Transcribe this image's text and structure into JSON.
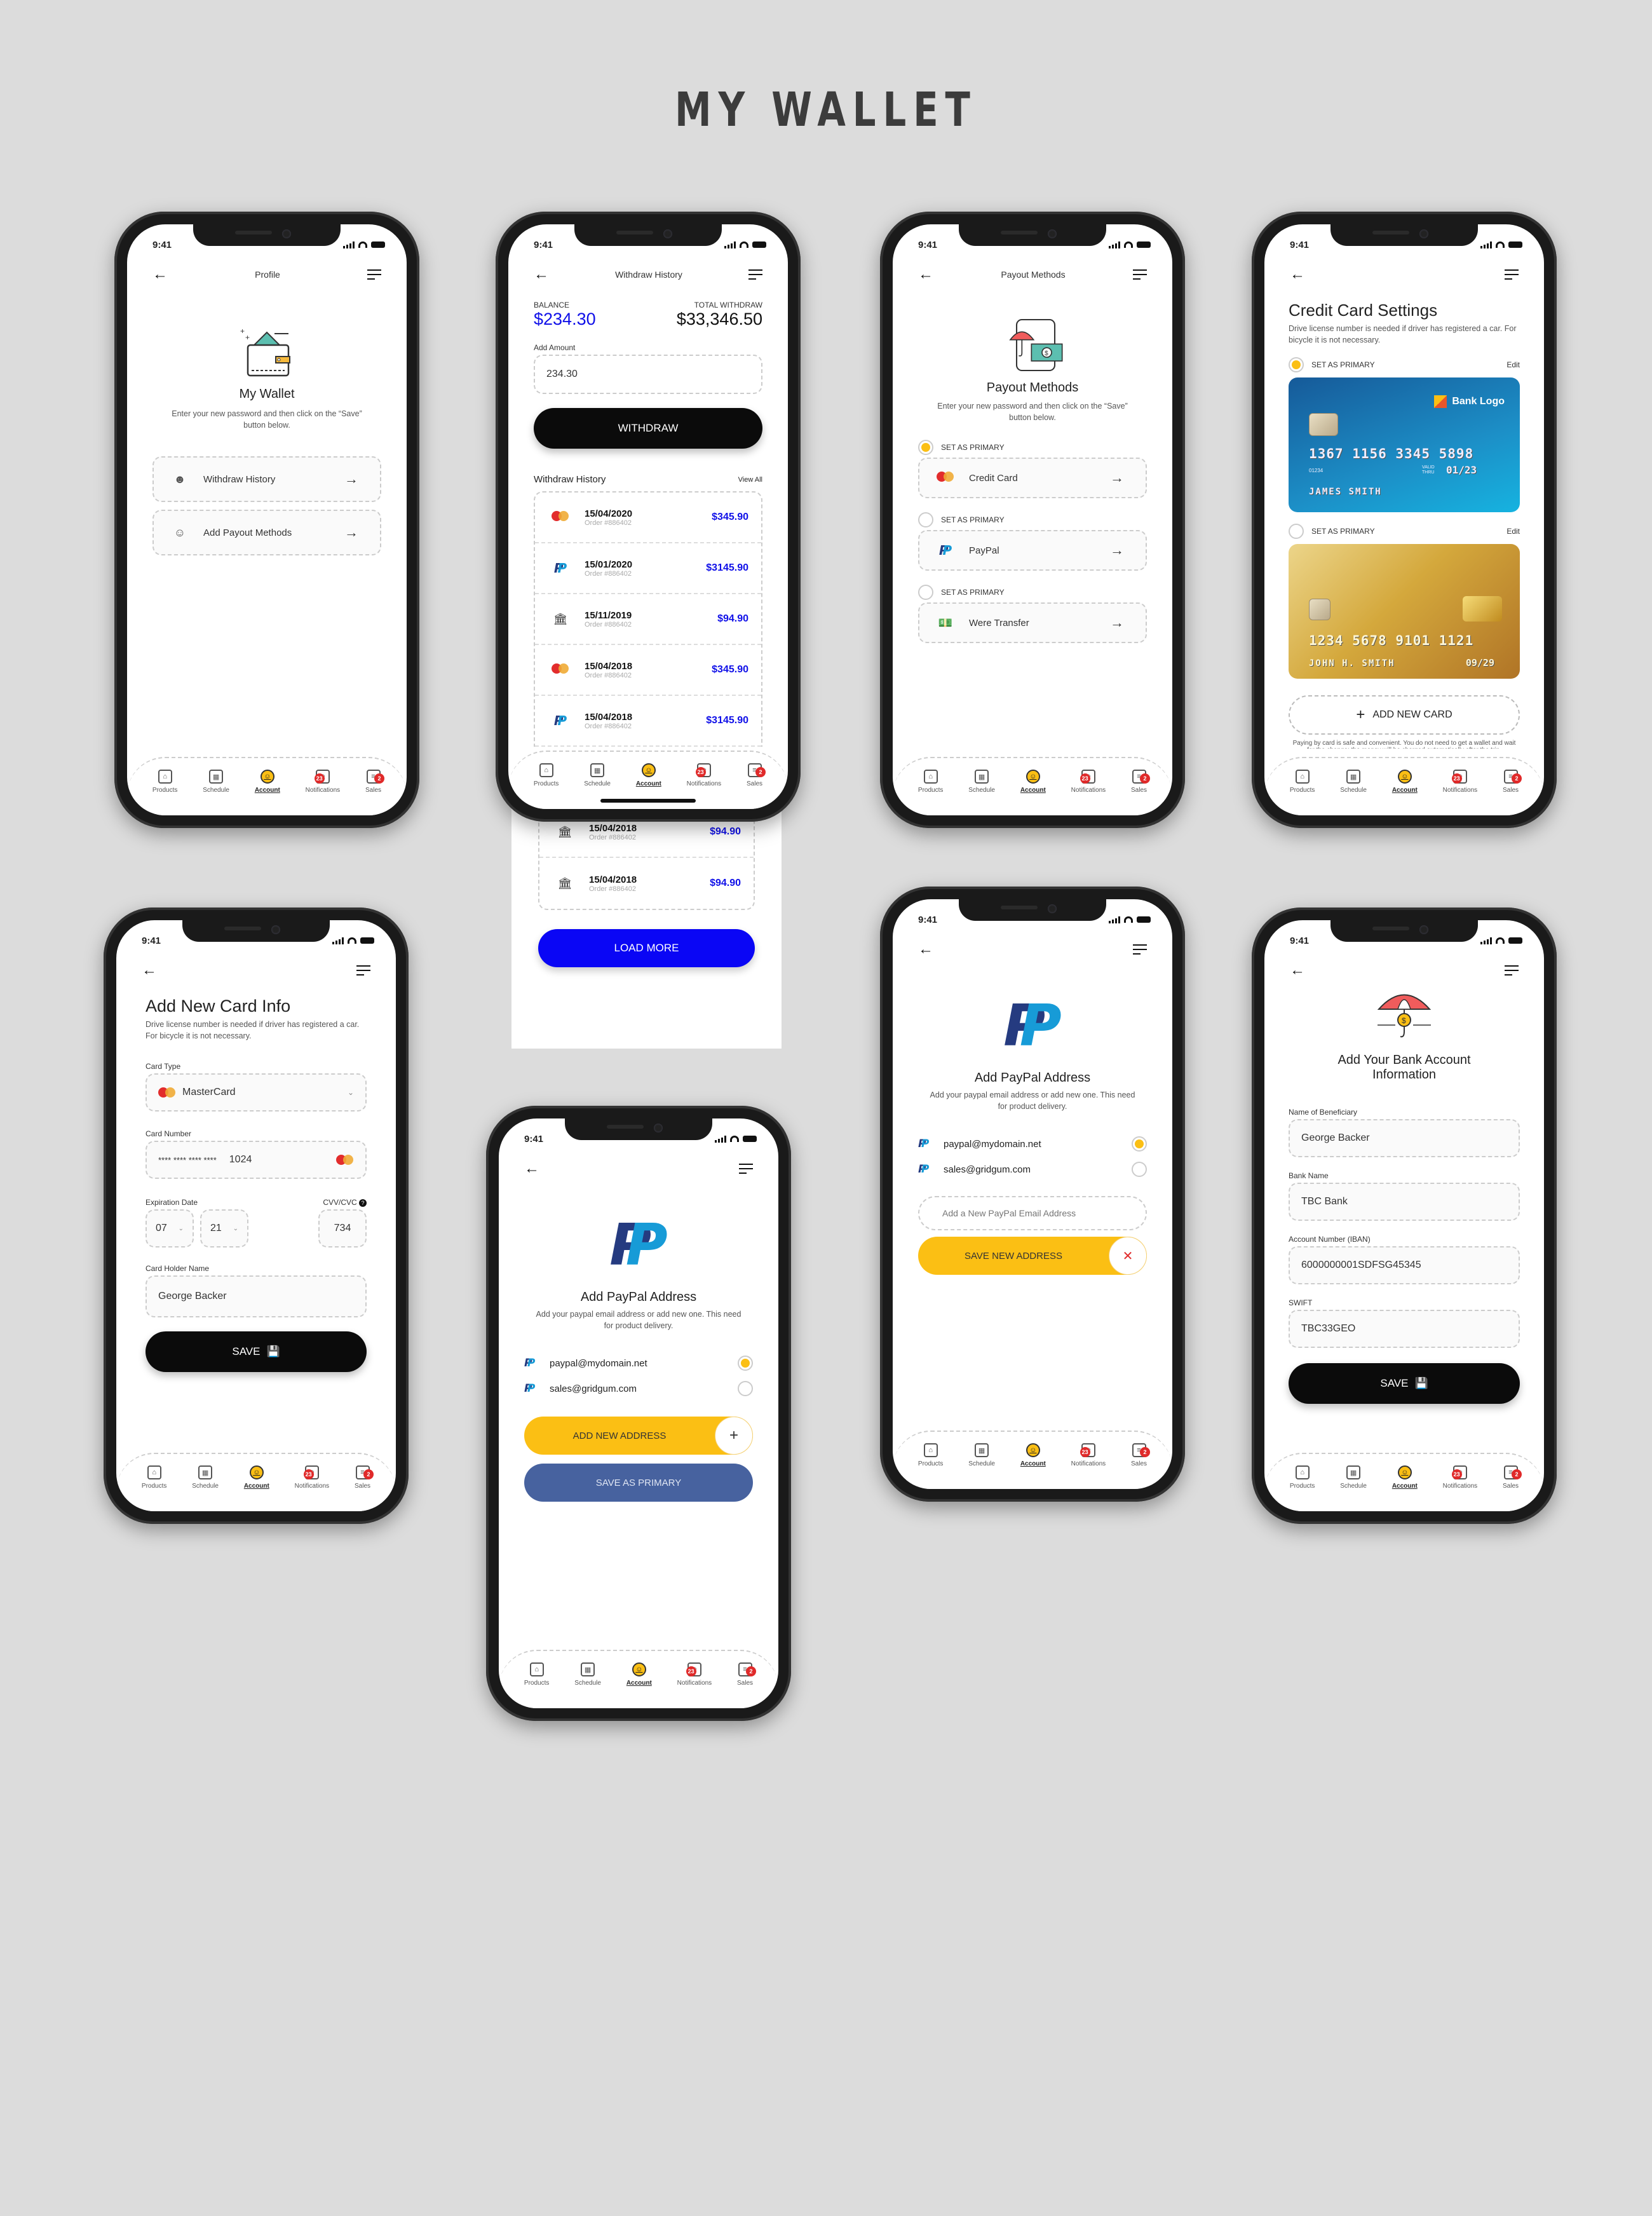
{
  "page_title": "MY WALLET",
  "status_time": "9:41",
  "tabbar": {
    "items": [
      {
        "label": "Products",
        "icon": "store-icon"
      },
      {
        "label": "Schedule",
        "icon": "calendar-icon"
      },
      {
        "label": "Account",
        "icon": "user-icon",
        "active": true
      },
      {
        "label": "Notifications",
        "icon": "bell-icon",
        "badge": "23"
      },
      {
        "label": "Sales",
        "icon": "receipt-icon",
        "badge": "2"
      }
    ]
  },
  "profile": {
    "nav_title": "Profile",
    "heading": "My Wallet",
    "subtitle": "Enter your new password and then click on the “Save” button below.",
    "items": [
      {
        "label": "Withdraw History",
        "icon": "withdraw-history-icon"
      },
      {
        "label": "Add Payout Methods",
        "icon": "add-payout-icon"
      }
    ]
  },
  "withdraw": {
    "nav_title": "Withdraw History",
    "balance_label": "BALANCE",
    "balance_value": "$234.30",
    "total_label": "TOTAL WITHDRAW",
    "total_value": "$33,346.50",
    "amount_label": "Add Amount",
    "amount_value": "234.30",
    "withdraw_button": "WITHDRAW",
    "history_title": "Withdraw History",
    "view_all": "View All",
    "rows": [
      {
        "method": "mastercard",
        "date": "15/04/2020",
        "order": "Order #886402",
        "amount": "$345.90"
      },
      {
        "method": "paypal",
        "date": "15/01/2020",
        "order": "Order #886402",
        "amount": "$3145.90"
      },
      {
        "method": "bank",
        "date": "15/11/2019",
        "order": "Order #886402",
        "amount": "$94.90"
      },
      {
        "method": "mastercard",
        "date": "15/04/2018",
        "order": "Order #886402",
        "amount": "$345.90"
      },
      {
        "method": "paypal",
        "date": "15/04/2018",
        "order": "Order #886402",
        "amount": "$3145.90"
      },
      {
        "method": "bank",
        "date": "15/04/2018",
        "order": "Order #886402",
        "amount": "$94.90"
      },
      {
        "method": "bank",
        "date": "15/04/2018",
        "order": "Order #886402",
        "amount": "$94.90"
      }
    ],
    "load_more": "LOAD MORE"
  },
  "payout": {
    "nav_title": "Payout Methods",
    "heading": "Payout Methods",
    "subtitle": "Enter your new password and then click on the “Save” button below.",
    "primary_label": "SET AS PRIMARY",
    "methods": [
      {
        "label": "Credit Card",
        "primary": true
      },
      {
        "label": "PayPal",
        "primary": false
      },
      {
        "label": "Were Transfer",
        "primary": false
      }
    ]
  },
  "cc_settings": {
    "heading": "Credit Card Settings",
    "subtitle": "Drive license number is needed if driver has registered a car. For bicycle it is not necessary.",
    "primary_label": "SET AS PRIMARY",
    "edit_label": "Edit",
    "cards": [
      {
        "style": "blue",
        "bank": "Bank Logo",
        "number": "1367 1156 3345 5898",
        "small": "01234",
        "valid_label": "VALID THRU",
        "expiry": "01/23",
        "name": "JAMES SMITH",
        "primary": true
      },
      {
        "style": "gold",
        "number": "1234 5678 9101 1121",
        "expiry": "09/29",
        "name": "JOHN H. SMITH",
        "primary": false
      }
    ],
    "add_card": "ADD NEW CARD",
    "footnote": "Paying by card is safe and convenient. You do not need to get a wallet and wait for the change; the money will be charged automatically after the trip."
  },
  "add_card": {
    "heading": "Add New Card Info",
    "subtitle": "Drive license number is needed if driver has registered a car. For bicycle it is not necessary.",
    "card_type_label": "Card Type",
    "card_type_value": "MasterCard",
    "card_number_label": "Card Number",
    "card_number_mask": "**** **** **** ****",
    "card_number_last": "1024",
    "expiry_label": "Expiration Date",
    "expiry_month": "07",
    "expiry_year": "21",
    "cvv_label": "CVV/CVC",
    "cvv_value": "734",
    "holder_label": "Card Holder Name",
    "holder_value": "George Backer",
    "save_button": "SAVE"
  },
  "paypal_add": {
    "heading": "Add PayPal Address",
    "subtitle": "Add your paypal email address or add new one. This need for product delivery.",
    "emails": [
      {
        "email": "paypal@mydomain.net",
        "selected": true
      },
      {
        "email": "sales@gridgum.com",
        "selected": false
      }
    ],
    "add_button": "ADD NEW ADDRESS",
    "save_primary_button": "SAVE AS PRIMARY"
  },
  "paypal_new": {
    "heading": "Add PayPal Address",
    "subtitle": "Add your paypal email address or add new one. This need for product delivery.",
    "emails": [
      {
        "email": "paypal@mydomain.net",
        "selected": true
      },
      {
        "email": "sales@gridgum.com",
        "selected": false
      }
    ],
    "input_placeholder": "Add a New PayPal Email Address",
    "save_button": "SAVE NEW ADDRESS"
  },
  "bank": {
    "heading": "Add Your Bank Account Information",
    "fields": [
      {
        "label": "Name of Beneficiary",
        "value": "George Backer"
      },
      {
        "label": "Bank Name",
        "value": "TBC Bank"
      },
      {
        "label": "Account Number (IBAN)",
        "value": "6000000001SDFSG45345"
      },
      {
        "label": "SWIFT",
        "value": "TBC33GEO"
      }
    ],
    "save_button": "SAVE"
  },
  "colors": {
    "accent_yellow": "#fbbf14",
    "accent_blue": "#0a06f5",
    "paypal_indigo": "#47629f",
    "badge_red": "#e02a2a"
  }
}
